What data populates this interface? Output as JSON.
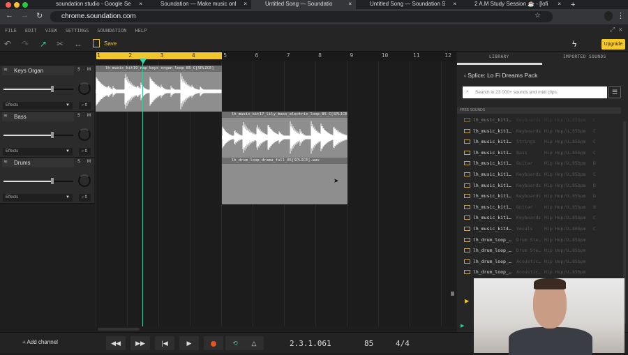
{
  "browser": {
    "tabs": [
      {
        "label": "soundation studio - Google Se",
        "active": false
      },
      {
        "label": "Soundation — Make music onl",
        "active": false
      },
      {
        "label": "Untitled Song — Soundatio",
        "active": true
      },
      {
        "label": "Untitled Song — Soundation S",
        "active": false
      },
      {
        "label": "2 A.M Study Session ☕ - [lofi",
        "active": false
      }
    ],
    "close": "×",
    "new_tab": "+",
    "url": "chrome.soundation.com"
  },
  "menu": [
    "FILE",
    "EDIT",
    "VIEW",
    "SETTINGS",
    "SOUNDATION",
    "HELP"
  ],
  "toolbar": {
    "save_label": "Save",
    "upgrade_label": "Upgrade"
  },
  "ruler": {
    "bars": [
      "1",
      "2",
      "3",
      "4",
      "5",
      "6",
      "7",
      "8",
      "9",
      "10",
      "11",
      "12"
    ]
  },
  "tracks": [
    {
      "name": "Keys Organ",
      "solo": "S",
      "mute": "M",
      "volume": 0.7,
      "effects": "Effects",
      "clip": "lh_music_kit19_nap_keys_organ_loop_85_C[SPLICE]"
    },
    {
      "name": "Bass",
      "solo": "S",
      "mute": "M",
      "volume": 0.7,
      "effects": "Effects",
      "clip": "lh_music_kit17_lily_bass_electric_loop_85_C[SPLICE]"
    },
    {
      "name": "Drums",
      "solo": "S",
      "mute": "M",
      "volume": 0.7,
      "effects": "Effects",
      "clip": "lh_drum_loop_drama_full_85[SPLICE].wav"
    }
  ],
  "library": {
    "tabs": [
      "LIBRARY",
      "IMPORTED SOUNDS"
    ],
    "pack": "Splice: Lo Fi Dreams Pack",
    "search_placeholder": "Search in 23 000+ sounds and midi clips",
    "section": "FREE SOUNDS",
    "rows": [
      [
        "lh_music_kit1…",
        "Keyboards",
        "Hip Hop/U…",
        "85bpm",
        "C"
      ],
      [
        "lh_music_kit1…",
        "Keyboards",
        "Hip Hop/U…",
        "85bpm",
        "C"
      ],
      [
        "lh_music_kit1…",
        "Strings",
        "Hip Hop/U…",
        "85bpm",
        "C"
      ],
      [
        "lh_music_kit1…",
        "Bass",
        "Hip Hop/U…",
        "85bpm",
        "C"
      ],
      [
        "lh_music_kit1…",
        "Guitar",
        "Hip Hop/U…",
        "85bpm",
        "D"
      ],
      [
        "lh_music_kit1…",
        "Keyboards",
        "Hip Hop/U…",
        "85bpm",
        "C"
      ],
      [
        "lh_music_kit1…",
        "Keyboards",
        "Hip Hop/U…",
        "85bpm",
        "D"
      ],
      [
        "lh_music_kit1…",
        "Keyboards",
        "Hip Hop/U…",
        "85bpm",
        "D"
      ],
      [
        "lh_music_kit1…",
        "Guitar",
        "Hip Hop/U…",
        "85bpm",
        "B"
      ],
      [
        "lh_music_kit1…",
        "Keyboards",
        "Hip Hop/U…",
        "85bpm",
        "C"
      ],
      [
        "lh_music_kit4…",
        "Vocals",
        "Hip Hop/U…",
        "80bpm",
        "C"
      ],
      [
        "lh_drum_loop_…",
        "Drum Ste…",
        "Hip Hop/U…",
        "85bpm",
        ""
      ],
      [
        "lh_drum_loop_…",
        "Drum Ste…",
        "Hip Hop/U…",
        "85bpm",
        ""
      ],
      [
        "lh_drum_loop_…",
        "Acoustic…",
        "Hip Hop/U…",
        "85bpm",
        ""
      ],
      [
        "lh_drum_loop_…",
        "Acoustic…",
        "Hip Hop/U…",
        "85bpm",
        ""
      ]
    ]
  },
  "transport": {
    "add_channel": "Add channel",
    "position": "2.3.1.061",
    "tempo": "85",
    "signature": "4/4"
  },
  "colors": {
    "accent": "#f0c52d",
    "playhead": "#3cc59b",
    "record": "#e8541e"
  }
}
